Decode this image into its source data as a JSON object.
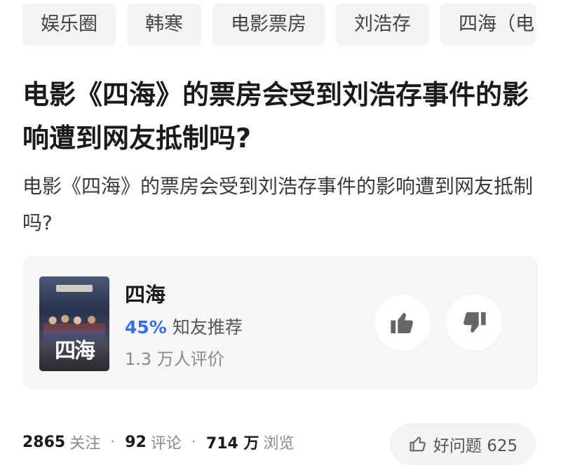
{
  "tags": [
    "娱乐圈",
    "韩寒",
    "电影票房",
    "刘浩存",
    "四海（电"
  ],
  "question": {
    "title": "电影《四海》的票房会受到刘浩存事件的影响遭到网友抵制吗?",
    "description": "电影《四海》的票房会受到刘浩存事件的影响遭到网友抵制吗?"
  },
  "movie_card": {
    "poster_title": "四海",
    "name": "四海",
    "recommend_pct": "45%",
    "recommend_label": "知友推荐",
    "ratings_text": "1.3 万人评价",
    "accent_color": "#3b6fd9",
    "thumb_up_icon": "thumb-up-icon",
    "thumb_down_icon": "thumb-down-icon"
  },
  "stats": {
    "follow_count": "2865",
    "follow_label": "关注",
    "comment_count": "92",
    "comment_label": "评论",
    "view_count": "714 万",
    "view_label": "浏览"
  },
  "good_question": {
    "label": "好问题 625",
    "icon": "thumb-up-outline-icon"
  }
}
